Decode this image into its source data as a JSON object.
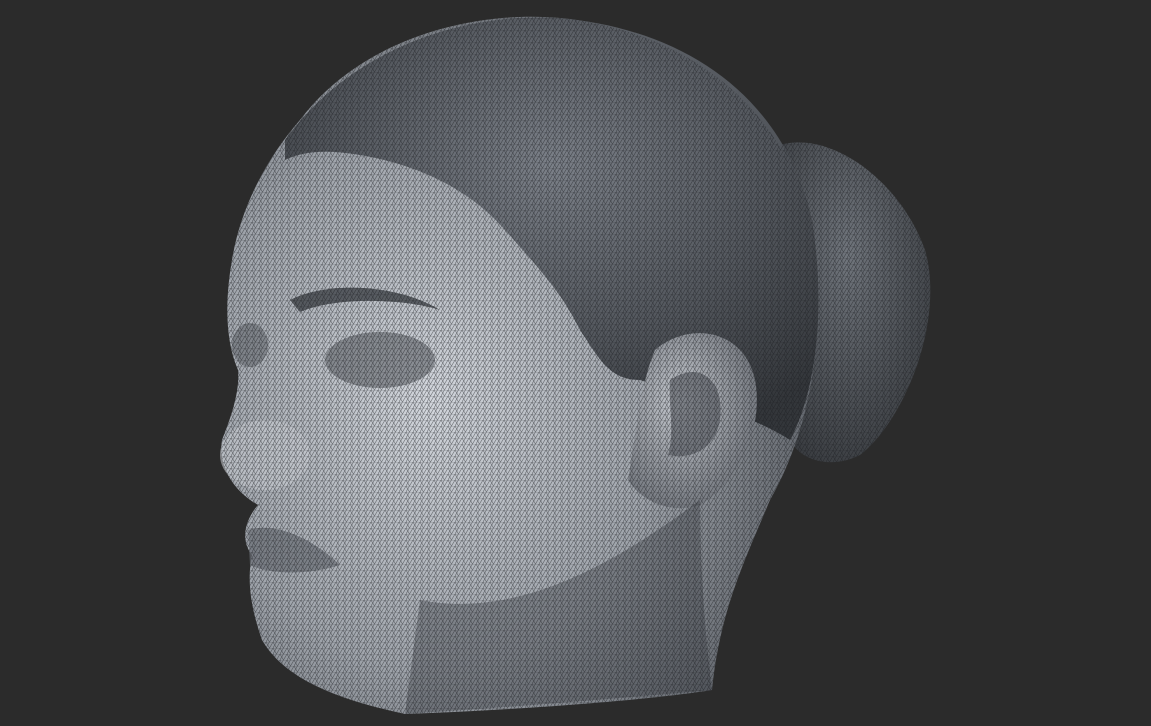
{
  "scene": {
    "subject": "head-mesh",
    "colors": {
      "background": "#2b2b2b",
      "skin_light": "#c9cdd3",
      "skin_mid": "#8d929a",
      "hair_dark": "#4a4d52",
      "wire": "#1c1d20"
    }
  }
}
